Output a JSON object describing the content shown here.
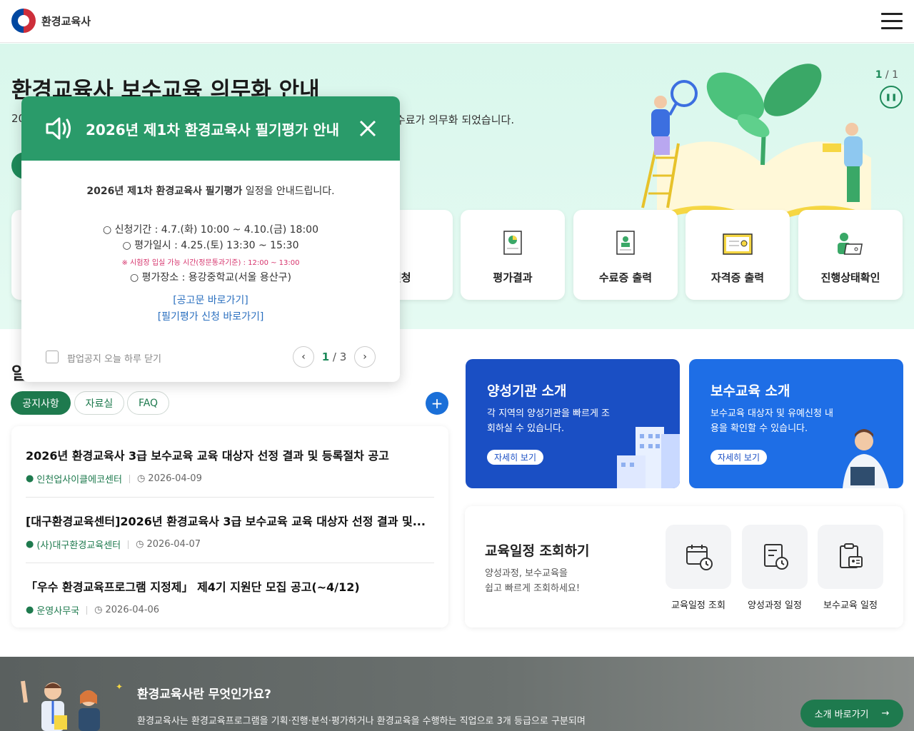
{
  "header": {
    "logo_text": "환경교육사"
  },
  "hero": {
    "title": "환경교육사 보수교육 의무화 안내",
    "desc_prefix": "20",
    "desc_suffix": "수료가 의무화 되었습니다.",
    "slide_current": "1",
    "slide_total": "1"
  },
  "quick_menu": [
    {
      "label": "신청",
      "icon": "application-icon"
    },
    {
      "label": "평가결과",
      "icon": "result-doc-icon"
    },
    {
      "label": "수료증 출력",
      "icon": "certificate-icon"
    },
    {
      "label": "자격증 출력",
      "icon": "license-icon"
    },
    {
      "label": "진행상태확인",
      "icon": "status-icon"
    }
  ],
  "notice": {
    "section_title_partial": "알",
    "tabs": [
      "공지사항",
      "자료실",
      "FAQ"
    ],
    "more_label": "+",
    "items": [
      {
        "title": "2026년 환경교육사 3급 보수교육 교육 대상자 선정 결과 및 등록절차 공고",
        "org": "인천업사이클에코센터",
        "date": "2026-04-09"
      },
      {
        "title": "[대구환경교육센터]2026년 환경교육사 3급 보수교육 교육 대상자 선정 결과 및...",
        "org": "(사)대구환경교육센터",
        "date": "2026-04-07"
      },
      {
        "title": "「우수 환경교육프로그램 지정제」 제4기 지원단 모집 공고(~4/12)",
        "org": "운영사무국",
        "date": "2026-04-06"
      }
    ]
  },
  "cards": [
    {
      "title": "양성기관 소개",
      "desc": "각 지역의 양성기관을 빠르게 조회하실 수 있습니다.",
      "button": "자세히 보기",
      "color": "#1a4fc4"
    },
    {
      "title": "보수교육 소개",
      "desc": "보수교육 대상자 및 유예신청 내용을 확인할 수 있습니다.",
      "button": "자세히 보기",
      "color": "#1e6ee6"
    }
  ],
  "schedule": {
    "title": "교육일정 조회하기",
    "desc_line1": "양성과정, 보수교육을",
    "desc_line2": "쉽고 빠르게 조회하세요!",
    "buttons": [
      "교육일정 조회",
      "양성과정 일정",
      "보수교육 일정"
    ]
  },
  "banner": {
    "title": "환경교육사란 무엇인가요?",
    "desc": "환경교육사는 환경교육프로그램을 기획·진행·분석·평가하거나 환경교육을 수행하는 직업으로 3개 등급으로 구분되며",
    "button": "소개 바로가기"
  },
  "popup": {
    "title": "2026년 제1차 환경교육사 필기평가 안내",
    "intro_bold": "2026년 제1차 환경교육사 필기평가",
    "intro_rest": " 일정을 안내드립니다.",
    "line1": "○ 신청기간 : 4.7.(화) 10:00 ~ 4.10.(금) 18:00",
    "line2": "○ 평가일시 : 4.25.(토) 13:30 ~ 15:30",
    "warn": "※ 시험장 입실 가능 시간(정문통과기준) : 12:00 ~ 13:00",
    "line3": "○ 평가장소 : 용강중학교(서울 용산구)",
    "link1": "[공고문 바로가기]",
    "link2": "[필기평가 신청 바로가기]",
    "checkbox_label": "팝업공지 오늘 하루 닫기",
    "page_current": "1",
    "page_total": "3"
  },
  "colors": {
    "primary_green": "#1e7a4e",
    "popup_green": "#2a9b6a",
    "hero_bg": "#d9f7ec",
    "accent_blue": "#1a6fd8"
  }
}
